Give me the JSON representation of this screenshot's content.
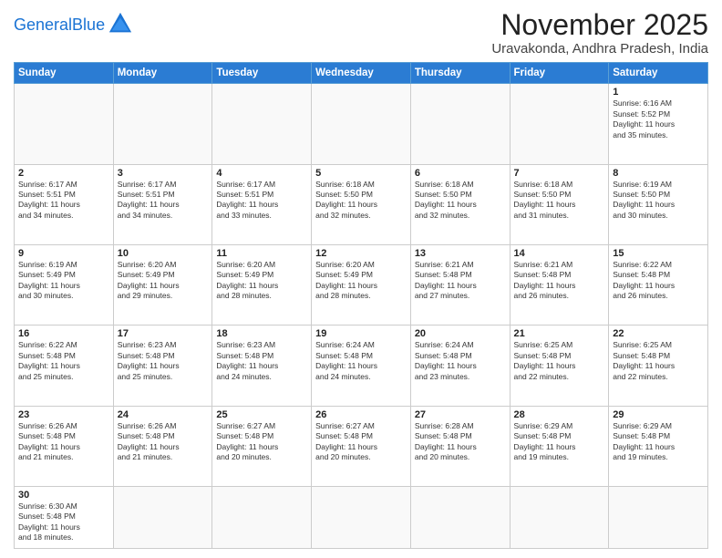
{
  "header": {
    "logo_general": "General",
    "logo_blue": "Blue",
    "month_title": "November 2025",
    "location": "Uravakonda, Andhra Pradesh, India"
  },
  "weekdays": [
    "Sunday",
    "Monday",
    "Tuesday",
    "Wednesday",
    "Thursday",
    "Friday",
    "Saturday"
  ],
  "weeks": [
    [
      {
        "day": "",
        "info": ""
      },
      {
        "day": "",
        "info": ""
      },
      {
        "day": "",
        "info": ""
      },
      {
        "day": "",
        "info": ""
      },
      {
        "day": "",
        "info": ""
      },
      {
        "day": "",
        "info": ""
      },
      {
        "day": "1",
        "info": "Sunrise: 6:16 AM\nSunset: 5:52 PM\nDaylight: 11 hours\nand 35 minutes."
      }
    ],
    [
      {
        "day": "2",
        "info": "Sunrise: 6:17 AM\nSunset: 5:51 PM\nDaylight: 11 hours\nand 34 minutes."
      },
      {
        "day": "3",
        "info": "Sunrise: 6:17 AM\nSunset: 5:51 PM\nDaylight: 11 hours\nand 34 minutes."
      },
      {
        "day": "4",
        "info": "Sunrise: 6:17 AM\nSunset: 5:51 PM\nDaylight: 11 hours\nand 33 minutes."
      },
      {
        "day": "5",
        "info": "Sunrise: 6:18 AM\nSunset: 5:50 PM\nDaylight: 11 hours\nand 32 minutes."
      },
      {
        "day": "6",
        "info": "Sunrise: 6:18 AM\nSunset: 5:50 PM\nDaylight: 11 hours\nand 32 minutes."
      },
      {
        "day": "7",
        "info": "Sunrise: 6:18 AM\nSunset: 5:50 PM\nDaylight: 11 hours\nand 31 minutes."
      },
      {
        "day": "8",
        "info": "Sunrise: 6:19 AM\nSunset: 5:50 PM\nDaylight: 11 hours\nand 30 minutes."
      }
    ],
    [
      {
        "day": "9",
        "info": "Sunrise: 6:19 AM\nSunset: 5:49 PM\nDaylight: 11 hours\nand 30 minutes."
      },
      {
        "day": "10",
        "info": "Sunrise: 6:20 AM\nSunset: 5:49 PM\nDaylight: 11 hours\nand 29 minutes."
      },
      {
        "day": "11",
        "info": "Sunrise: 6:20 AM\nSunset: 5:49 PM\nDaylight: 11 hours\nand 28 minutes."
      },
      {
        "day": "12",
        "info": "Sunrise: 6:20 AM\nSunset: 5:49 PM\nDaylight: 11 hours\nand 28 minutes."
      },
      {
        "day": "13",
        "info": "Sunrise: 6:21 AM\nSunset: 5:48 PM\nDaylight: 11 hours\nand 27 minutes."
      },
      {
        "day": "14",
        "info": "Sunrise: 6:21 AM\nSunset: 5:48 PM\nDaylight: 11 hours\nand 26 minutes."
      },
      {
        "day": "15",
        "info": "Sunrise: 6:22 AM\nSunset: 5:48 PM\nDaylight: 11 hours\nand 26 minutes."
      }
    ],
    [
      {
        "day": "16",
        "info": "Sunrise: 6:22 AM\nSunset: 5:48 PM\nDaylight: 11 hours\nand 25 minutes."
      },
      {
        "day": "17",
        "info": "Sunrise: 6:23 AM\nSunset: 5:48 PM\nDaylight: 11 hours\nand 25 minutes."
      },
      {
        "day": "18",
        "info": "Sunrise: 6:23 AM\nSunset: 5:48 PM\nDaylight: 11 hours\nand 24 minutes."
      },
      {
        "day": "19",
        "info": "Sunrise: 6:24 AM\nSunset: 5:48 PM\nDaylight: 11 hours\nand 24 minutes."
      },
      {
        "day": "20",
        "info": "Sunrise: 6:24 AM\nSunset: 5:48 PM\nDaylight: 11 hours\nand 23 minutes."
      },
      {
        "day": "21",
        "info": "Sunrise: 6:25 AM\nSunset: 5:48 PM\nDaylight: 11 hours\nand 22 minutes."
      },
      {
        "day": "22",
        "info": "Sunrise: 6:25 AM\nSunset: 5:48 PM\nDaylight: 11 hours\nand 22 minutes."
      }
    ],
    [
      {
        "day": "23",
        "info": "Sunrise: 6:26 AM\nSunset: 5:48 PM\nDaylight: 11 hours\nand 21 minutes."
      },
      {
        "day": "24",
        "info": "Sunrise: 6:26 AM\nSunset: 5:48 PM\nDaylight: 11 hours\nand 21 minutes."
      },
      {
        "day": "25",
        "info": "Sunrise: 6:27 AM\nSunset: 5:48 PM\nDaylight: 11 hours\nand 20 minutes."
      },
      {
        "day": "26",
        "info": "Sunrise: 6:27 AM\nSunset: 5:48 PM\nDaylight: 11 hours\nand 20 minutes."
      },
      {
        "day": "27",
        "info": "Sunrise: 6:28 AM\nSunset: 5:48 PM\nDaylight: 11 hours\nand 20 minutes."
      },
      {
        "day": "28",
        "info": "Sunrise: 6:29 AM\nSunset: 5:48 PM\nDaylight: 11 hours\nand 19 minutes."
      },
      {
        "day": "29",
        "info": "Sunrise: 6:29 AM\nSunset: 5:48 PM\nDaylight: 11 hours\nand 19 minutes."
      }
    ],
    [
      {
        "day": "30",
        "info": "Sunrise: 6:30 AM\nSunset: 5:48 PM\nDaylight: 11 hours\nand 18 minutes."
      },
      {
        "day": "",
        "info": ""
      },
      {
        "day": "",
        "info": ""
      },
      {
        "day": "",
        "info": ""
      },
      {
        "day": "",
        "info": ""
      },
      {
        "day": "",
        "info": ""
      },
      {
        "day": "",
        "info": ""
      }
    ]
  ]
}
